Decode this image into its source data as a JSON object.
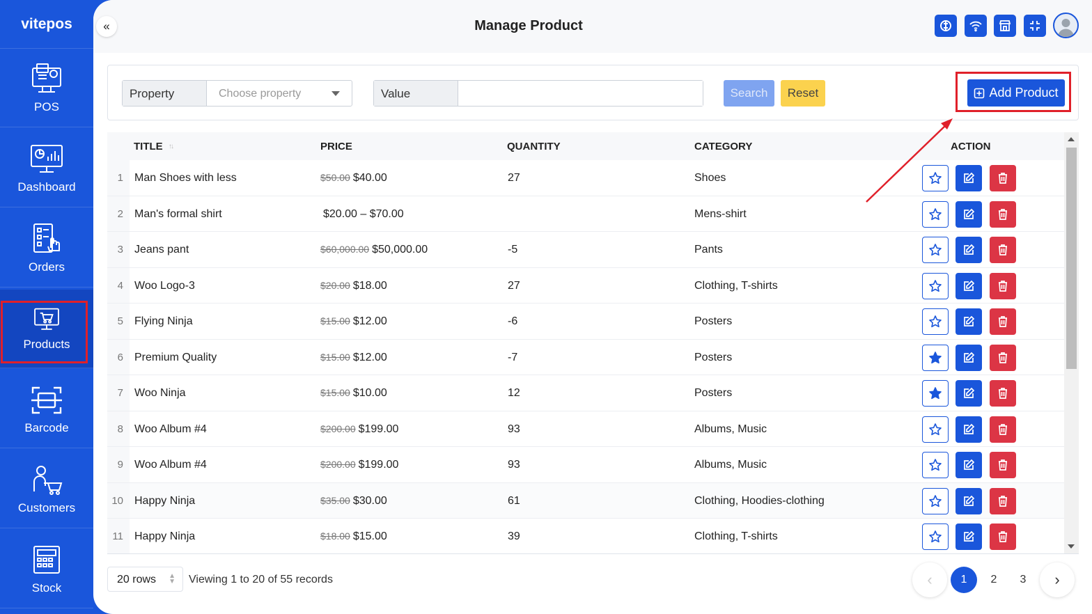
{
  "brand": "vitepos",
  "sidebar": {
    "items": [
      {
        "label": "POS",
        "icon": "pos-terminal-icon"
      },
      {
        "label": "Dashboard",
        "icon": "dashboard-chart-icon"
      },
      {
        "label": "Orders",
        "icon": "orders-clipboard-icon"
      },
      {
        "label": "Products",
        "icon": "products-monitor-icon",
        "active": true
      },
      {
        "label": "Barcode",
        "icon": "barcode-scan-icon"
      },
      {
        "label": "Customers",
        "icon": "customer-cart-icon"
      },
      {
        "label": "Stock",
        "icon": "stock-calculator-icon"
      }
    ]
  },
  "header": {
    "title": "Manage Product",
    "buttons": [
      "sync-icon",
      "wifi-icon",
      "store-icon",
      "fullscreen-exit-icon"
    ]
  },
  "filter": {
    "property_label": "Property",
    "property_placeholder": "Choose property",
    "value_label": "Value",
    "value_input": "",
    "search_label": "Search",
    "reset_label": "Reset",
    "add_label": "Add Product"
  },
  "table": {
    "headers": {
      "title": "TITLE",
      "price": "PRICE",
      "quantity": "QUANTITY",
      "category": "CATEGORY",
      "action": "ACTION"
    },
    "rows": [
      {
        "idx": "1",
        "title": "Man Shoes with less",
        "old_price": "$50.00",
        "price": "$40.00",
        "qty": "27",
        "category": "Shoes",
        "starred": false
      },
      {
        "idx": "2",
        "title": "Man's formal shirt",
        "old_price": "",
        "price": "$20.00 – $70.00",
        "qty": "",
        "category": "Mens-shirt",
        "starred": false
      },
      {
        "idx": "3",
        "title": "Jeans pant",
        "old_price": "$60,000.00",
        "price": "$50,000.00",
        "qty": "-5",
        "category": "Pants",
        "starred": false
      },
      {
        "idx": "4",
        "title": "Woo Logo-3",
        "old_price": "$20.00",
        "price": "$18.00",
        "qty": "27",
        "category": "Clothing, T-shirts",
        "starred": false
      },
      {
        "idx": "5",
        "title": "Flying Ninja",
        "old_price": "$15.00",
        "price": "$12.00",
        "qty": "-6",
        "category": "Posters",
        "starred": false
      },
      {
        "idx": "6",
        "title": "Premium Quality",
        "old_price": "$15.00",
        "price": "$12.00",
        "qty": "-7",
        "category": "Posters",
        "starred": true
      },
      {
        "idx": "7",
        "title": "Woo Ninja",
        "old_price": "$15.00",
        "price": "$10.00",
        "qty": "12",
        "category": "Posters",
        "starred": true
      },
      {
        "idx": "8",
        "title": "Woo Album #4",
        "old_price": "$200.00",
        "price": "$199.00",
        "qty": "93",
        "category": "Albums, Music",
        "starred": false
      },
      {
        "idx": "9",
        "title": "Woo Album #4",
        "old_price": "$200.00",
        "price": "$199.00",
        "qty": "93",
        "category": "Albums, Music",
        "starred": false
      },
      {
        "idx": "10",
        "title": "Happy Ninja",
        "old_price": "$35.00",
        "price": "$30.00",
        "qty": "61",
        "category": "Clothing, Hoodies-clothing",
        "starred": false
      },
      {
        "idx": "11",
        "title": "Happy Ninja",
        "old_price": "$18.00",
        "price": "$15.00",
        "qty": "39",
        "category": "Clothing, T-shirts",
        "starred": false
      }
    ]
  },
  "footer": {
    "rows_select": "20 rows",
    "viewing": "Viewing 1 to 20 of 55 records",
    "pages": [
      "1",
      "2",
      "3"
    ],
    "current_page": "1",
    "prev": "‹",
    "next": "›"
  },
  "colors": {
    "primary": "#1a56db",
    "danger": "#dc3545",
    "warning": "#fbd24e",
    "highlight": "#e0202a"
  }
}
